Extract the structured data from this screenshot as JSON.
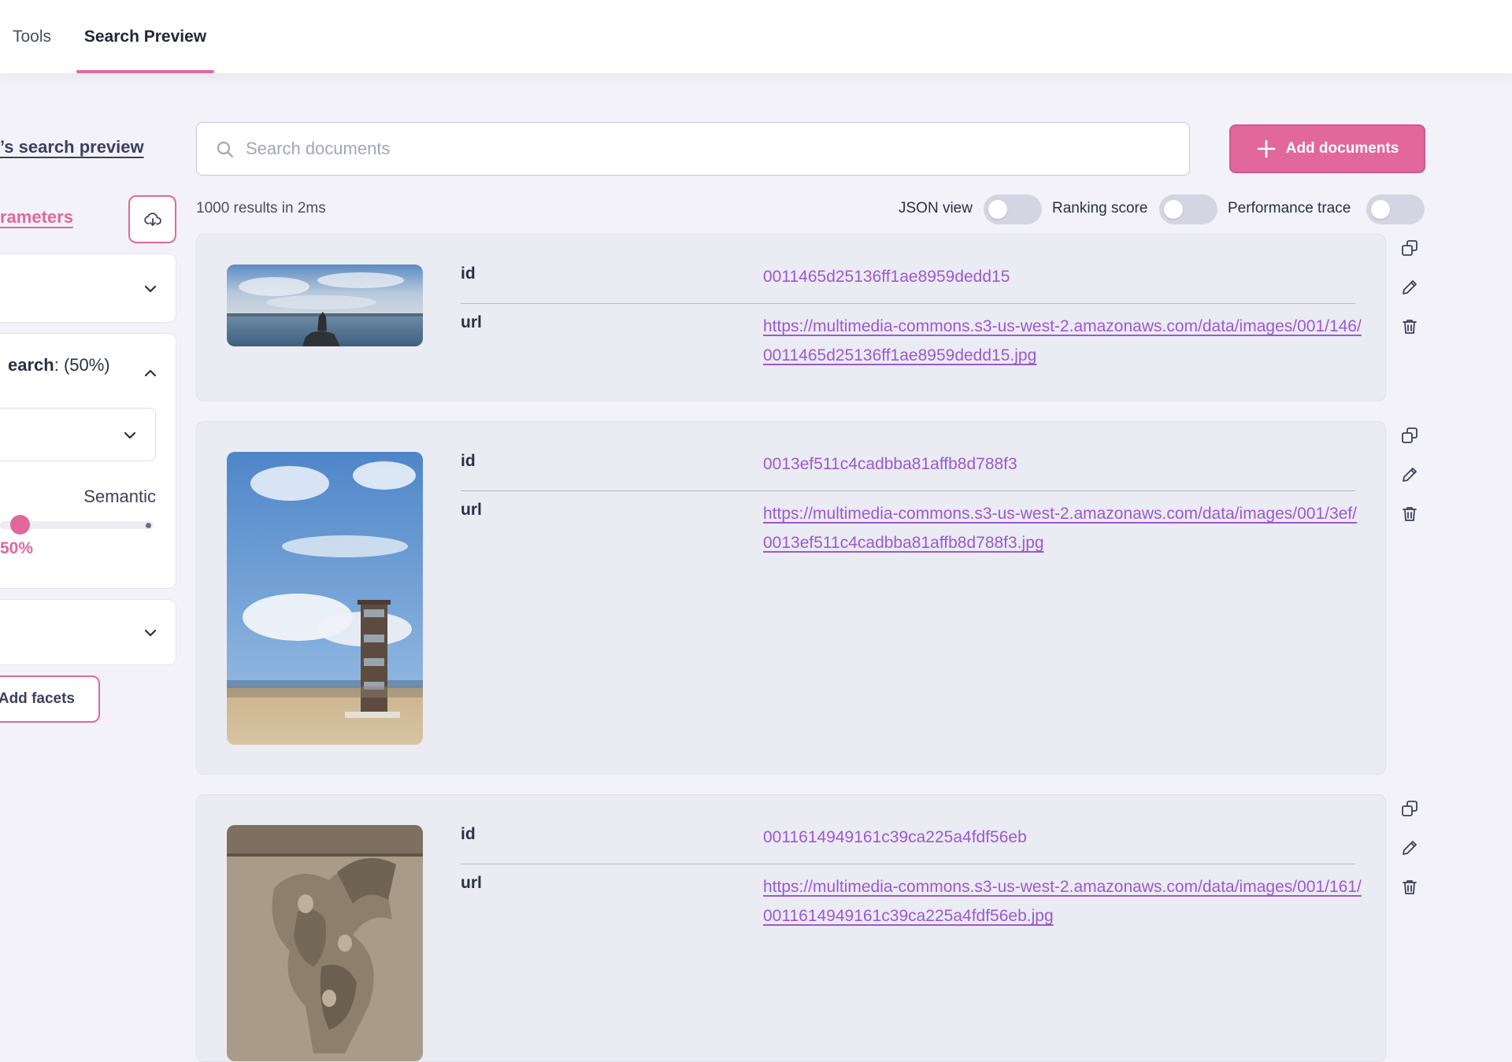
{
  "tabs": {
    "tools": "Tools",
    "search_preview": "Search Preview"
  },
  "sidebar": {
    "index_link": "’s search preview",
    "params_link": "rameters",
    "import_icon": "cloud-download-icon",
    "hybrid_prefix": "earch",
    "hybrid_suffix": ": (50%)",
    "semantic_label": "Semantic",
    "semantic_ratio": 0.5,
    "slider_value": "50%",
    "add_facets": "Add facets"
  },
  "search": {
    "placeholder": "Search documents",
    "add_documents": "Add documents"
  },
  "results": {
    "count_text": "1000 results in 2ms",
    "toggles": [
      {
        "label": "JSON view",
        "on": false
      },
      {
        "label": "Ranking score",
        "on": false
      },
      {
        "label": "Performance trace",
        "on": false
      }
    ]
  },
  "documents": [
    {
      "id_key": "id",
      "id": "0011465d25136ff1ae8959dedd15",
      "url_key": "url",
      "url": "https://multimedia-commons.s3-us-west-2.amazonaws.com/data/images/001/146/0011465d25136ff1ae8959dedd15.jpg"
    },
    {
      "id_key": "id",
      "id": "0013ef511c4cadbba81affb8d788f3",
      "url_key": "url",
      "url": "https://multimedia-commons.s3-us-west-2.amazonaws.com/data/images/001/3ef/0013ef511c4cadbba81affb8d788f3.jpg"
    },
    {
      "id_key": "id",
      "id": "0011614949161c39ca225a4fdf56eb",
      "url_key": "url",
      "url": "https://multimedia-commons.s3-us-west-2.amazonaws.com/data/images/001/161/0011614949161c39ca225a4fdf56eb.jpg"
    }
  ],
  "colors": {
    "accent": "#e2679d",
    "link": "#9b59d0"
  }
}
